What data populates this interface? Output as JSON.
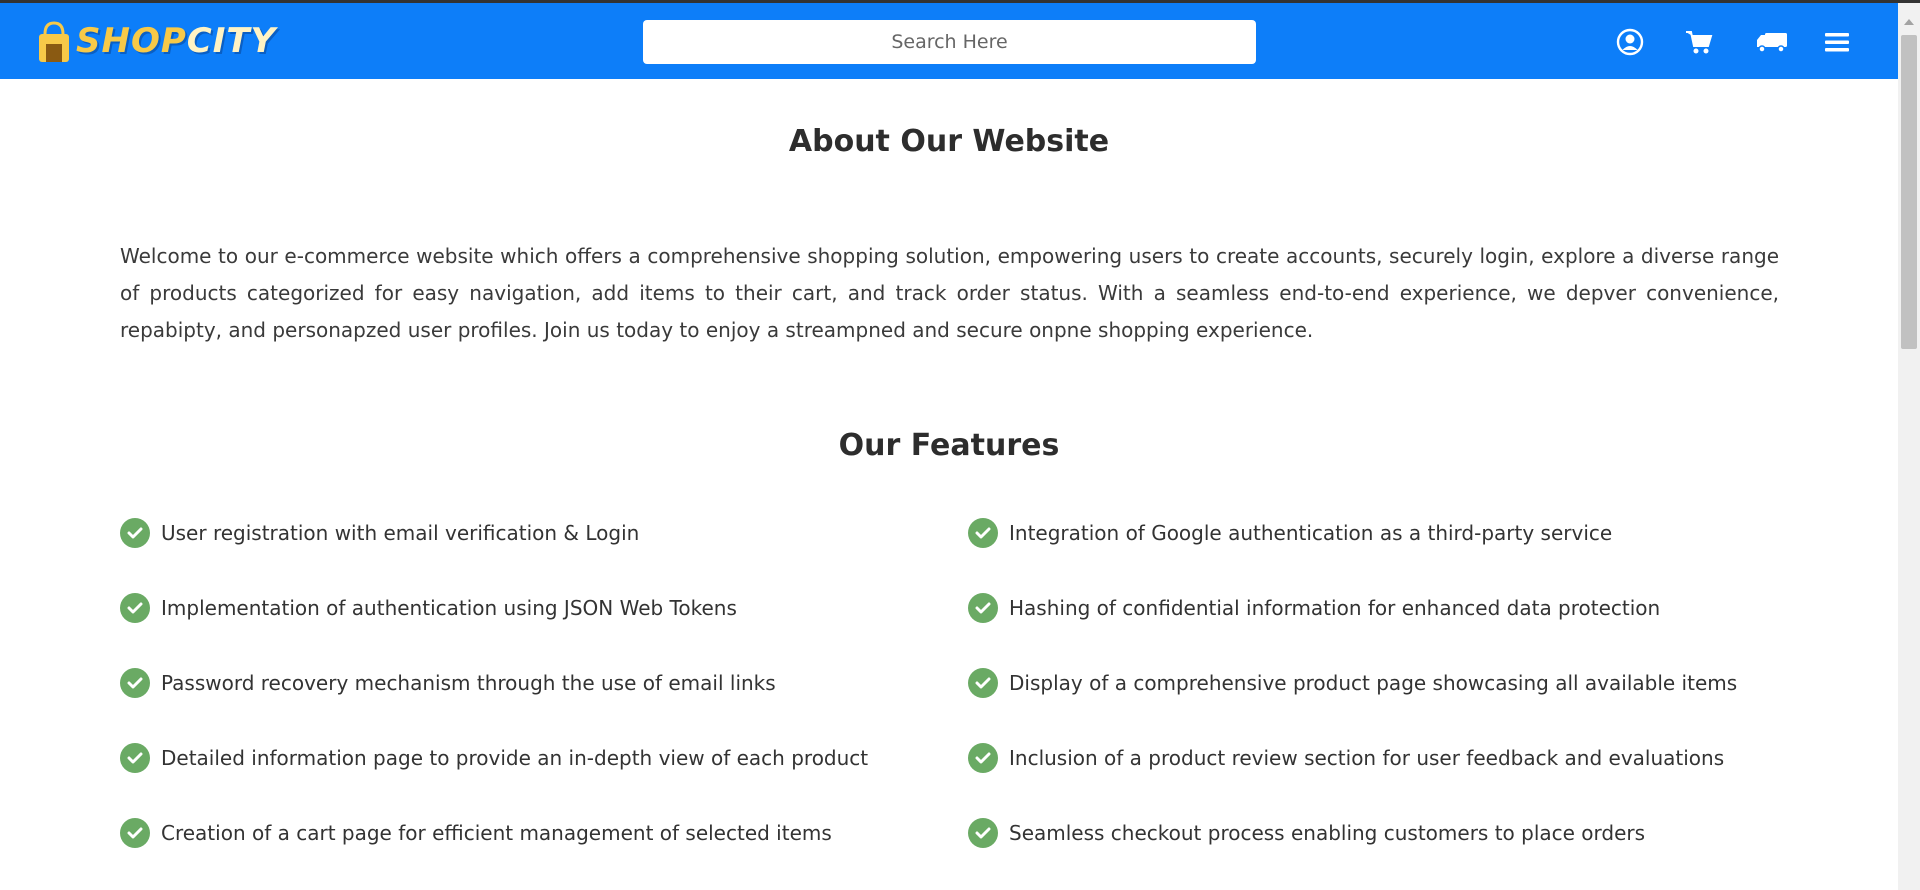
{
  "header": {
    "logo_text_shop": "SHOP",
    "logo_text_city": "CITY",
    "search_placeholder": "Search Here",
    "icons": [
      "user-circle-icon",
      "cart-icon",
      "truck-icon",
      "menu-icon"
    ],
    "brand_color": "#0d7ef9"
  },
  "about": {
    "title": "About Our Website",
    "text": "Welcome to our e-commerce website which offers a comprehensive shopping solution, empowering users to create accounts, securely login, explore a diverse range of products categorized for easy navigation, add items to their cart, and track order status. With a seamless end-to-end experience, we depver convenience, repabipty, and personapzed user profiles. Join us today to enjoy a streampned and secure onpne shopping experience."
  },
  "features": {
    "title": "Our Features",
    "check_color": "#6aaa64",
    "items": [
      "User registration with email verification & Login",
      "Integration of Google authentication as a third-party service",
      "Implementation of authentication using JSON Web Tokens",
      "Hashing of confidential information for enhanced data protection",
      "Password recovery mechanism through the use of email links",
      "Display of a comprehensive product page showcasing all available items",
      "Detailed information page to provide an in-depth view of each product",
      "Inclusion of a product review section for user feedback and evaluations",
      "Creation of a cart page for efficient management of selected items",
      "Seamless checkout process enabling customers to place orders"
    ]
  }
}
